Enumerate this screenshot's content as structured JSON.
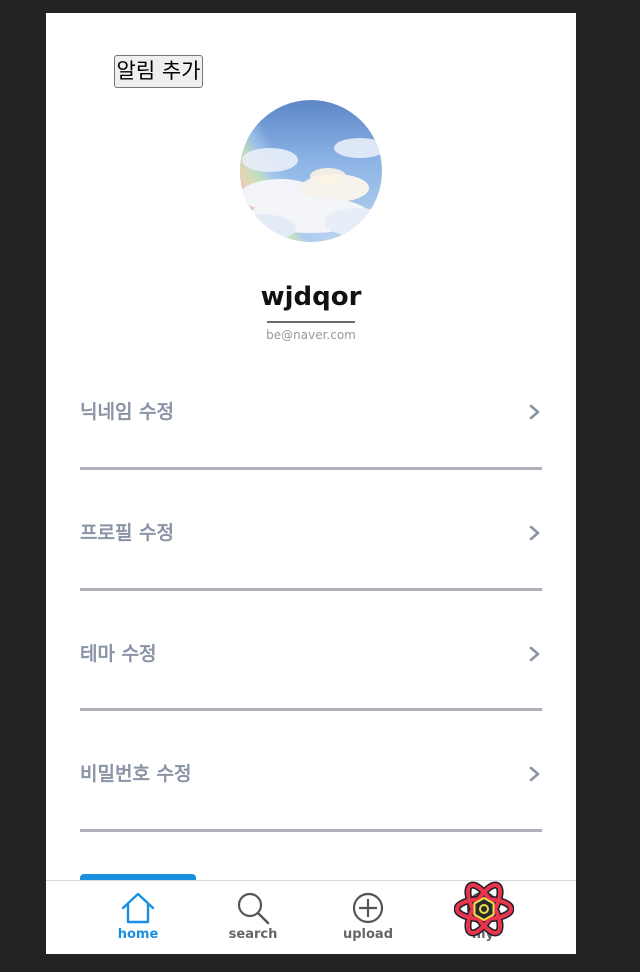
{
  "header": {
    "alarm_button_label": "알림 추가"
  },
  "profile": {
    "username": "wjdqor",
    "email": "be@naver.com",
    "avatar_icon": "rainbow-sky-avatar"
  },
  "menu": [
    {
      "label": "닉네임 수정",
      "icon": "chevron-right-icon"
    },
    {
      "label": "프로필 수정",
      "icon": "chevron-right-icon"
    },
    {
      "label": "테마 수정",
      "icon": "chevron-right-icon"
    },
    {
      "label": "비밀번호 수정",
      "icon": "chevron-right-icon"
    }
  ],
  "tabbar": {
    "tabs": [
      {
        "label": "home",
        "icon": "home-icon",
        "active": true
      },
      {
        "label": "search",
        "icon": "search-icon",
        "active": false
      },
      {
        "label": "upload",
        "icon": "plus-circle-icon",
        "active": false
      },
      {
        "label": "my",
        "icon": "circle-icon",
        "active": false
      }
    ]
  },
  "colors": {
    "accent": "#1a8fe0",
    "menu_text": "#8a94a6",
    "divider": "#aeb2b8",
    "background": "#222222",
    "react_logo": "#e8354b"
  }
}
